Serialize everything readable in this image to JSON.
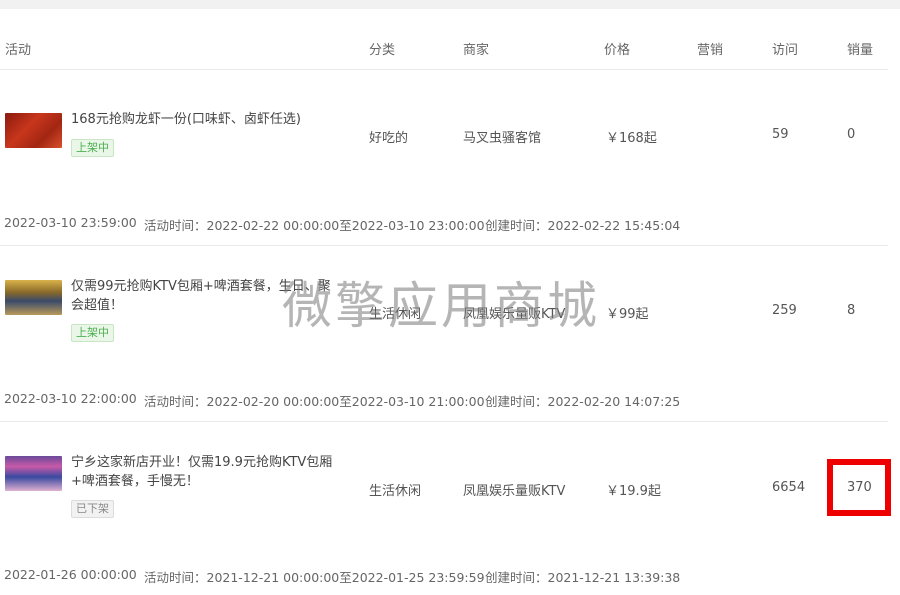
{
  "columns": {
    "activity": "活动",
    "category": "分类",
    "merchant": "商家",
    "price": "价格",
    "marketing": "营销",
    "visits": "访问",
    "sales": "销量"
  },
  "rows": [
    {
      "title": "168元抢购龙虾一份(口味虾、卤虾任选)",
      "status": "上架中",
      "category": "好吃的",
      "merchant": "马叉虫骚客馆",
      "price": "￥168起",
      "visits": "59",
      "sales": "0",
      "end_time": "2022-03-10 23:59:00",
      "activity_time": "活动时间：2022-02-22 00:00:00至2022-03-10 23:00:00",
      "created_time": "创建时间：2022-02-22 15:45:04"
    },
    {
      "title": "仅需99元抢购KTV包厢+啤酒套餐，生日、聚会超值！",
      "status": "上架中",
      "category": "生活休闲",
      "merchant": "凤凰娱乐量贩KTV",
      "price": "￥99起",
      "visits": "259",
      "sales": "8",
      "end_time": "2022-03-10 22:00:00",
      "activity_time": "活动时间：2022-02-20 00:00:00至2022-03-10 21:00:00",
      "created_time": "创建时间：2022-02-20 14:07:25"
    },
    {
      "title": "宁乡这家新店开业！仅需19.9元抢购KTV包厢+啤酒套餐，手慢无！",
      "status": "已下架",
      "category": "生活休闲",
      "merchant": "凤凰娱乐量贩KTV",
      "price": "￥19.9起",
      "visits": "6654",
      "sales": "370",
      "end_time": "2022-01-26 00:00:00",
      "activity_time": "活动时间：2021-12-21 00:00:00至2022-01-25 23:59:59",
      "created_time": "创建时间：2021-12-21 13:39:38"
    }
  ],
  "watermark": "微擎应用商城",
  "colors": {
    "status_on": "#4caf50",
    "status_off": "#8a8a8a",
    "highlight": "#ee0000"
  }
}
